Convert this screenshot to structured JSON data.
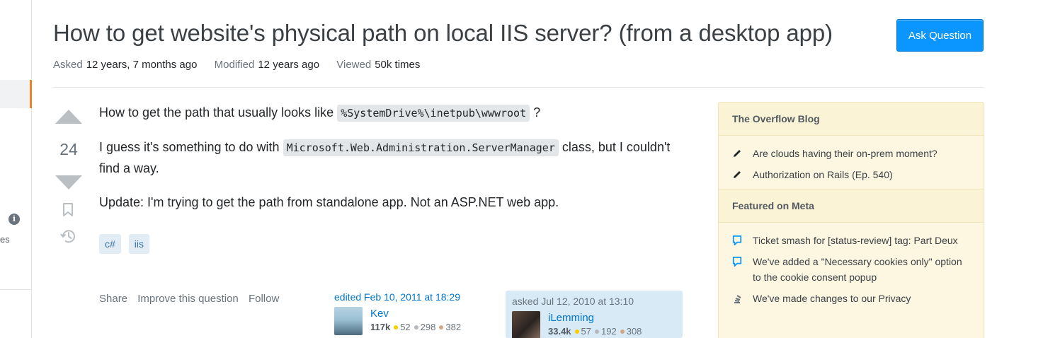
{
  "question": {
    "title": "How to get website's physical path on local IIS server? (from a desktop app)",
    "ask_button": "Ask Question",
    "meta": {
      "asked_label": "Asked",
      "asked_value": "12 years, 7 months ago",
      "modified_label": "Modified",
      "modified_value": "12 years ago",
      "viewed_label": "Viewed",
      "viewed_value": "50k times"
    },
    "votes": "24",
    "body": {
      "p1_before": "How to get the path that usually looks like ",
      "p1_code": "%SystemDrive%\\inetpub\\wwwroot",
      "p1_after": " ?",
      "p2_before": "I guess it's something to do with ",
      "p2_code": "Microsoft.Web.Administration.ServerManager",
      "p2_after": " class, but I couldn't find a way.",
      "p3": "Update: I'm trying to get the path from standalone app. Not an ASP.NET web app."
    },
    "tags": [
      "c#",
      "iis"
    ],
    "menu": {
      "share": "Share",
      "improve": "Improve this question",
      "follow": "Follow"
    },
    "editor": {
      "action": "edited Feb 10, 2011 at 18:29",
      "name": "Kev",
      "rep": "117k",
      "gold": "52",
      "silver": "298",
      "bronze": "382"
    },
    "asker": {
      "action": "asked Jul 12, 2010 at 13:10",
      "name": "iLemming",
      "rep": "33.4k",
      "gold": "57",
      "silver": "192",
      "bronze": "308"
    }
  },
  "left_sidebar": {
    "fragment_text": "es"
  },
  "sidebar_widget": {
    "blog_header": "The Overflow Blog",
    "blog_items": [
      {
        "icon": "pencil-icon",
        "text": "Are clouds having their on-prem moment?"
      },
      {
        "icon": "pencil-icon",
        "text": "Authorization on Rails (Ep. 540)"
      }
    ],
    "meta_header": "Featured on Meta",
    "meta_items": [
      {
        "icon": "speech-bubble-icon",
        "text": "Ticket smash for [status-review] tag: Part Deux"
      },
      {
        "icon": "speech-bubble-icon",
        "text": "We've added a \"Necessary cookies only\" option to the cookie consent popup"
      },
      {
        "icon": "stack-icon",
        "text": "We've made changes to our Privacy"
      }
    ]
  },
  "colors": {
    "accent": "#0a95ff",
    "tag_bg": "#e1ecf4",
    "tag_fg": "#39739d",
    "widget_bg": "#fdf7e2",
    "active_nav": "#f48225"
  }
}
